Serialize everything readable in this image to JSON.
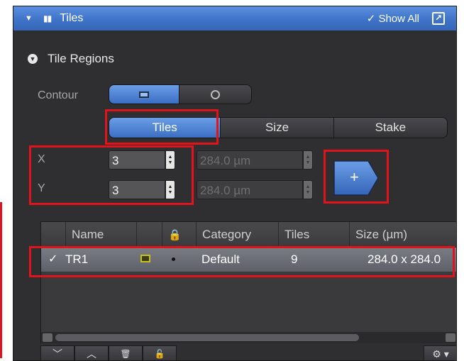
{
  "colors": {
    "accent": "#3f74c9",
    "highlight": "#e1141b",
    "panel": "#2f2f31"
  },
  "titlebar": {
    "chevron_icon": "chevron-down-icon",
    "module_icon": "tiles-icon",
    "title": "Tiles",
    "show_all": "✓ Show All",
    "popout_icon": "popout-icon"
  },
  "section": {
    "title": "Tile Regions",
    "icon": "collapse-bullet-icon"
  },
  "contour": {
    "label": "Contour",
    "options": [
      "rectangle-icon",
      "circle-icon"
    ],
    "selected": 0
  },
  "tabs": {
    "items": [
      "Tiles",
      "Size",
      "Stake"
    ],
    "selected": 0
  },
  "tiles": {
    "x_label": "X",
    "x_value": "3",
    "x_size": "284.0 µm",
    "y_label": "Y",
    "y_value": "3",
    "y_size": "284.0 µm",
    "add_label": "+"
  },
  "table": {
    "headers": [
      "",
      "Name",
      "",
      "",
      "Category",
      "Tiles",
      "Size (µm)"
    ],
    "rows": [
      {
        "checked": "✓",
        "name": "TR1",
        "category": "Default",
        "tiles": "9",
        "size": "284.0 x 284.0"
      }
    ]
  },
  "bottombar": {
    "buttons": [
      "﹀",
      "︿",
      "🗑",
      "🔓"
    ],
    "settings": "⚙ ▾"
  }
}
